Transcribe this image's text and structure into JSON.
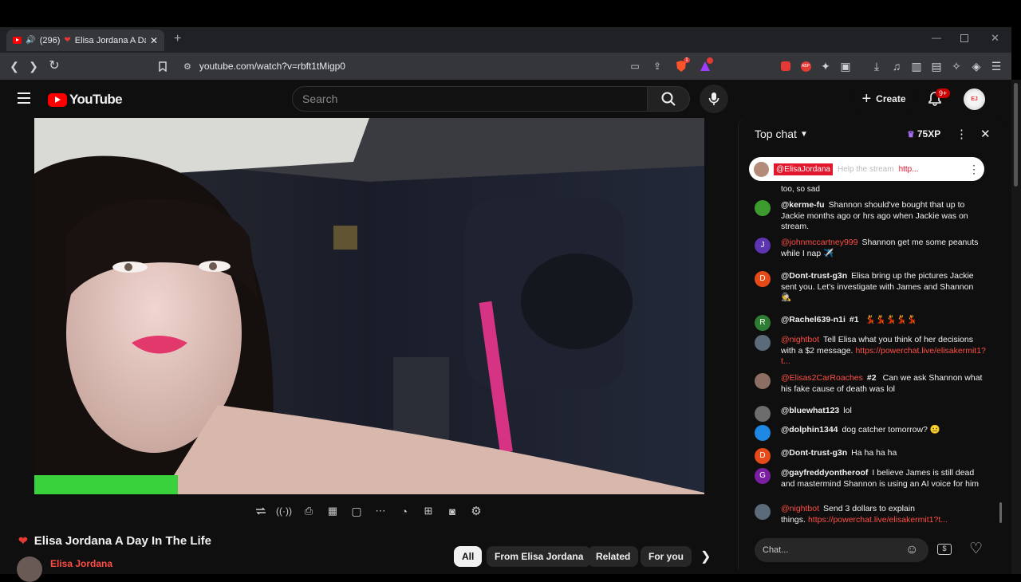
{
  "browser": {
    "tab_count_label": "(296)",
    "tab_title": "Elisa Jordana A Day",
    "url": "youtube.com/watch?v=rbft1tMigp0",
    "shields_badge": "1"
  },
  "youtube": {
    "logo_text": "YouTube",
    "search_placeholder": "Search",
    "create_label": "Create",
    "notifications_badge": "9+"
  },
  "video": {
    "title": "Elisa Jordana A Day In The Life",
    "channel": "Elisa Jordana"
  },
  "chips": [
    "All",
    "From Elisa Jordana",
    "Related",
    "For you"
  ],
  "chat": {
    "header": "Top chat",
    "xp": "75XP",
    "pinned_user": "@ElisaJordana",
    "pinned_text": "Help the stream",
    "pinned_link": "http...",
    "top_fragment": "too, so sad",
    "input_placeholder": "Chat...",
    "messages": [
      {
        "user": "@kerme-fu",
        "text": "Shannon should've bought that up to Jackie months ago or hrs ago when Jackie was on stream.",
        "avatar": "",
        "color": "#3d9a2f"
      },
      {
        "user": "@johnmccartney999",
        "text": "Shannon get me some peanuts while I nap ✈️",
        "avatar": "J",
        "color": "#5e35b1"
      },
      {
        "user": "@Dont-trust-g3n",
        "text": "Elisa bring up the pictures Jackie sent you. Let's investigate with James and Shannon 🕵️",
        "avatar": "D",
        "color": "#e64a19"
      },
      {
        "user": "@Rachel639-n1i",
        "rank": "#1",
        "text": "💃💃💃💃💃",
        "avatar": "R",
        "color": "#2e7d32"
      },
      {
        "user": "@nightbot",
        "text": "Tell Elisa what you think of her decisions with a $2 message.",
        "link": "https://powerchat.live/elisakermit1?t...",
        "avatar": "",
        "color": "#5c6b7a"
      },
      {
        "user": "@Elisas2CarRoaches",
        "rank": "#2",
        "text": "Can we ask Shannon what his fake cause of death was lol",
        "avatar": "",
        "color": "#8d6e63"
      },
      {
        "user": "@bluewhat123",
        "text": "lol",
        "avatar": "",
        "color": "#6d6d6d"
      },
      {
        "user": "@dolphin1344",
        "text": "dog catcher tomorrow? 😐",
        "avatar": "",
        "color": "#1e88e5"
      },
      {
        "user": "@Dont-trust-g3n",
        "text": "Ha ha ha ha",
        "avatar": "D",
        "color": "#e64a19"
      },
      {
        "user": "@gayfreddyontheroof",
        "text": "I believe James is still dead and mastermind Shannon is using an AI voice for him",
        "avatar": "G",
        "color": "#7b1fa2"
      },
      {
        "user": "@nightbot",
        "text": "Send 3 dollars to explain things.",
        "link": "https://powerchat.live/elisakermit1?t...",
        "avatar": "",
        "color": "#5c6b7a"
      }
    ]
  }
}
